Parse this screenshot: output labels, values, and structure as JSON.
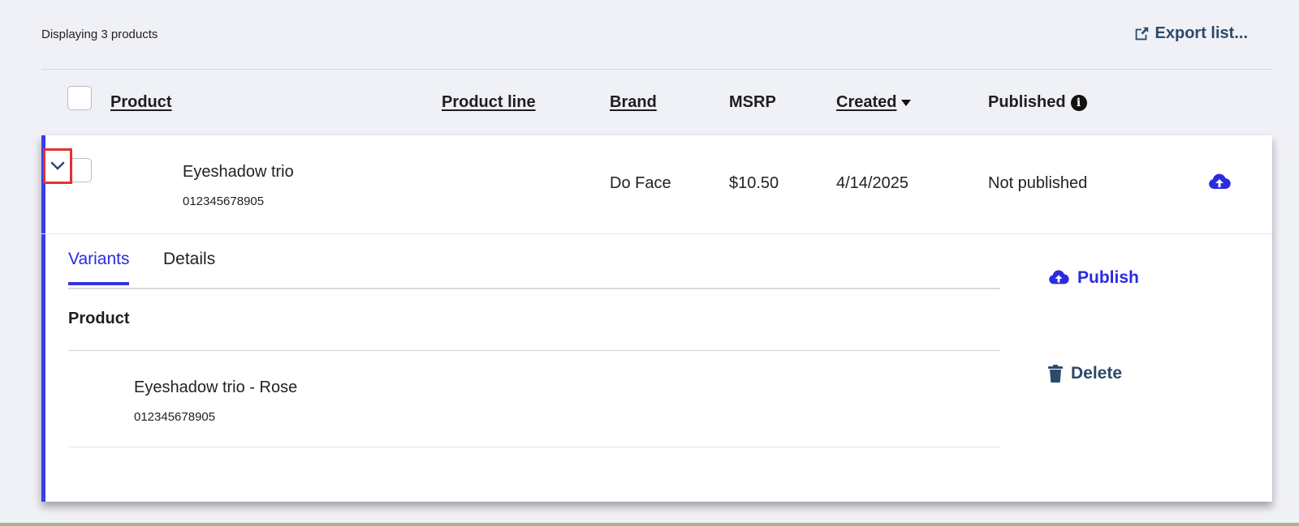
{
  "toolbar": {
    "count_text": "Displaying 3 products",
    "export_label": "Export list..."
  },
  "columns": {
    "product": "Product",
    "product_line": "Product line",
    "brand": "Brand",
    "msrp": "MSRP",
    "created": "Created",
    "published": "Published"
  },
  "row": {
    "name": "Eyeshadow trio",
    "sku": "012345678905",
    "brand": "Do Face",
    "msrp": "$10.50",
    "created": "4/14/2025",
    "published": "Not published"
  },
  "detail": {
    "tabs": [
      "Variants",
      "Details"
    ],
    "active_tab": "Variants",
    "variants_header": "Product",
    "variants": [
      {
        "name": "Eyeshadow trio - Rose",
        "sku": "012345678905"
      }
    ],
    "actions": {
      "publish": "Publish",
      "delete": "Delete"
    }
  },
  "colors": {
    "accent": "#3b3be8",
    "link_blue": "#2b2be0",
    "slate": "#2d4a6b",
    "highlight": "#e53030"
  },
  "icons": [
    "export-icon",
    "caret-down-icon",
    "info-icon",
    "chevron-down-icon",
    "cloud-upload-icon",
    "trash-icon"
  ]
}
